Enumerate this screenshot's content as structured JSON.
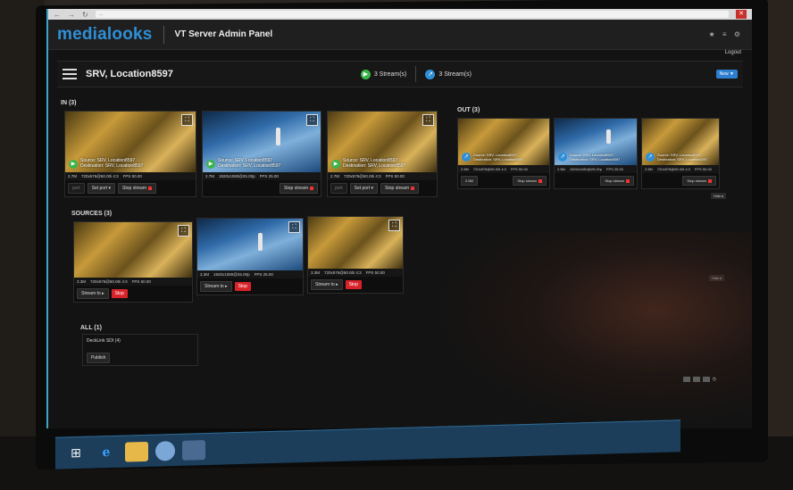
{
  "browser": {
    "url": "..."
  },
  "app": {
    "logo": "medialooks",
    "title": "VT Server Admin Panel",
    "logout": "Logout"
  },
  "server": {
    "name": "SRV, Location8597",
    "in_count_label": "3 Stream(s)",
    "out_count_label": "3 Stream(s)",
    "new_label": "New ▼"
  },
  "in": {
    "label": "IN (3)",
    "cards": [
      {
        "source": "Source: SRV, Location8597",
        "dest": "Destination: SRV, Location8597",
        "size": "2.7M",
        "format": "720x576@50.00i 4:3",
        "fps": "FPS 50.00",
        "port": "port",
        "set_port": "Set port ▾",
        "stop": "Stop stream"
      },
      {
        "source": "Source: SRV, Location8597",
        "dest": "Destination: SRV, Location8597",
        "size": "2.7M",
        "format": "1920x1080@25.00p",
        "fps": "FPS 25.00",
        "stop": "Stop stream"
      },
      {
        "source": "Source: SRV, Location8597",
        "dest": "Destination: SRV, Location8597",
        "size": "2.7M",
        "format": "720x576@50.00i 4:3",
        "fps": "FPS 50.00",
        "port": "port",
        "set_port": "Set port ▾",
        "stop": "Stop stream"
      }
    ]
  },
  "out": {
    "label": "OUT (3)",
    "cards": [
      {
        "source": "Source: SRV, Location8597",
        "dest": "Destination: SRV, Location8597",
        "size": "2.5M",
        "format": "720x576@50.00i 4:3",
        "fps": "FPS 50.00",
        "input": "2.5M",
        "stop": "Stop stream"
      },
      {
        "source": "Source: SRV, Location8597",
        "dest": "Destination: SRV, Location8597",
        "size": "2.5M",
        "format": "1920x1080@25.00p",
        "fps": "FPS 25.00",
        "stop": "Stop stream"
      },
      {
        "source": "Source: SRV, Location8597",
        "dest": "Destination: SRV, Location8597",
        "size": "2.5M",
        "format": "720x576@50.00i 4:3",
        "fps": "FPS 50.00",
        "stop": "Stop stream"
      }
    ],
    "more": "Hide ▸"
  },
  "sources": {
    "label": "SOURCES (3)",
    "cards": [
      {
        "size": "3.3M",
        "format": "720x576@50.00i 4:3",
        "fps": "FPS 50.00",
        "stream_to": "Stream to ▸",
        "stop": "Stop"
      },
      {
        "size": "3.3M",
        "format": "1920x1080@25.00p",
        "fps": "FPS 25.00",
        "stream_to": "Stream to ▸",
        "stop": "Stop"
      },
      {
        "size": "3.3M",
        "format": "720x576@50.00i 4:3",
        "fps": "FPS 50.00",
        "stream_to": "Stream to ▸",
        "stop": "Stop"
      }
    ],
    "more": "Hide ▸"
  },
  "all": {
    "label": "ALL (1)",
    "device": "DeckLink SDI (4)",
    "publish": "Publish"
  },
  "colors": {
    "accent": "#2f8fd6",
    "stop": "#d9232a",
    "in_badge": "#3bb54a",
    "out_badge": "#2f8fd6"
  }
}
